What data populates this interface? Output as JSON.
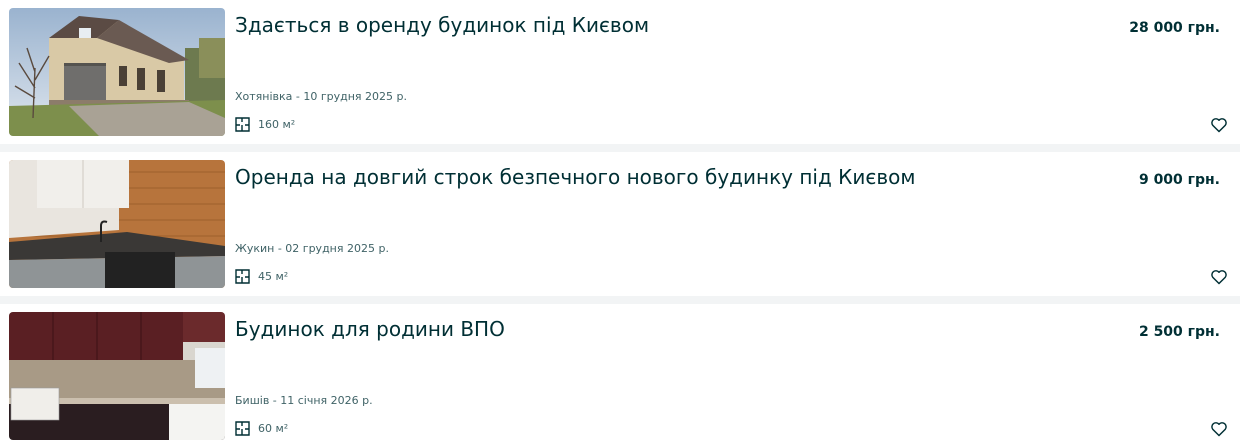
{
  "listings": [
    {
      "title": "Здається в оренду будинок під Києвом",
      "price": "28 000 грн.",
      "location_date": "Хотянівка - 10 грудня 2025 р.",
      "area": "160 м²",
      "image_alt": "house-photo"
    },
    {
      "title": "Оренда на довгий строк безпечного нового будинку під Києвом",
      "price": "9 000 грн.",
      "location_date": "Жукин - 02 грудня 2025 р.",
      "area": "45 м²",
      "image_alt": "kitchen-photo"
    },
    {
      "title": "Будинок для родини ВПО",
      "price": "2 500 грн.",
      "location_date": "Бишів - 11 січня 2026 р.",
      "area": "60 м²",
      "image_alt": "kitchen-photo"
    }
  ],
  "icons": {
    "area": "floor-plan-icon",
    "favorite": "heart-outline-icon"
  },
  "colors": {
    "text": "#002f34",
    "muted": "#406367",
    "background": "#f2f4f5",
    "card": "#ffffff"
  }
}
